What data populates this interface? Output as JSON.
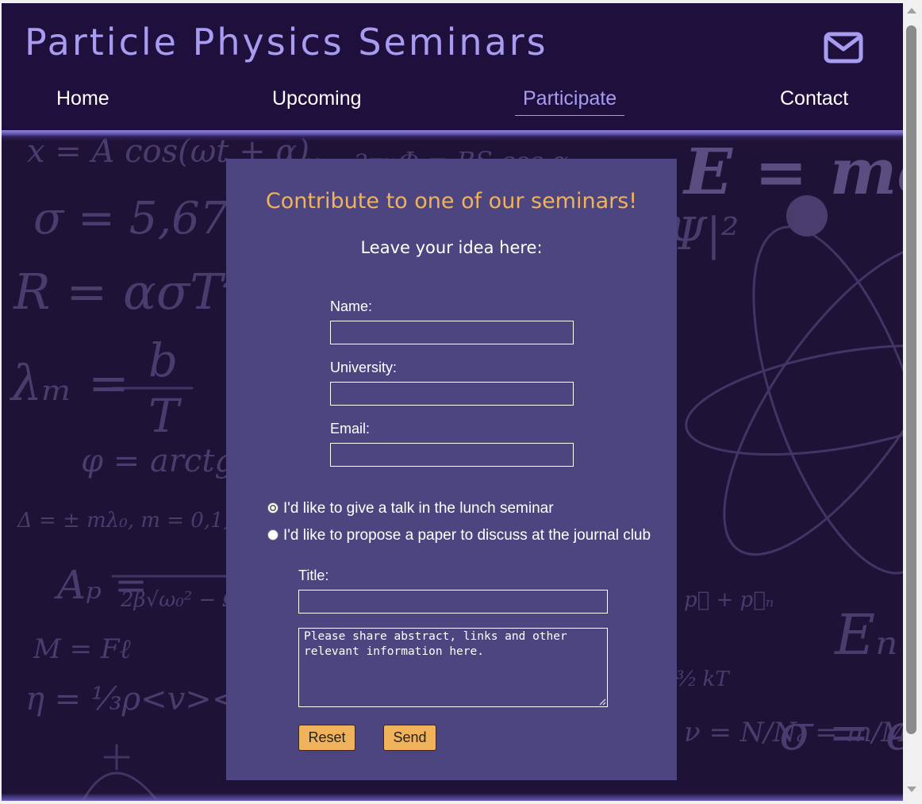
{
  "header": {
    "site_title": "Particle Physics Seminars",
    "mail_icon": "envelope-icon"
  },
  "nav": {
    "items": [
      {
        "label": "Home",
        "active": false
      },
      {
        "label": "Upcoming",
        "active": false
      },
      {
        "label": "Participate",
        "active": true
      },
      {
        "label": "Contact",
        "active": false
      }
    ]
  },
  "form": {
    "title": "Contribute to one of our seminars!",
    "subtitle": "Leave your idea here:",
    "name_label": "Name:",
    "name_value": "",
    "university_label": "University:",
    "university_value": "",
    "email_label": "Email:",
    "email_value": "",
    "options": [
      {
        "label": "I'd like to give a talk in the lunch seminar",
        "checked": true
      },
      {
        "label": "I'd like to propose a paper to discuss at the journal club",
        "checked": false
      }
    ],
    "title_label": "Title:",
    "title_value": "",
    "details_placeholder": "Please share abstract, links and other relevant information here.",
    "reset_label": "Reset",
    "send_label": "Send"
  },
  "colors": {
    "header_bg": "#1f0f3d",
    "accent_purple": "#a79cf0",
    "card_bg": "#4d4580",
    "title_orange": "#f0b25a",
    "button_bg": "#f0b25a"
  }
}
